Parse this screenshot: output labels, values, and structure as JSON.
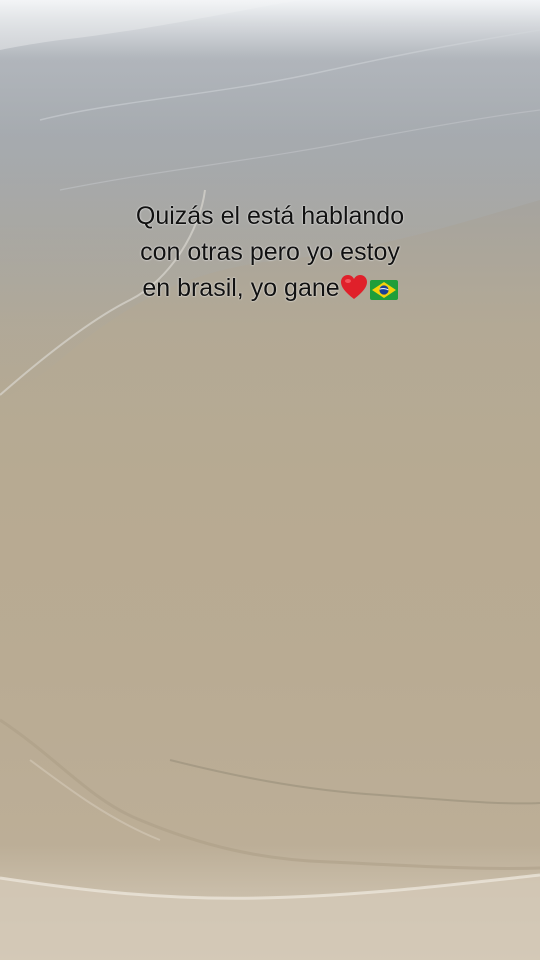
{
  "caption": {
    "line1": "Quizás el está hablando",
    "line2": "con otras pero yo estoy",
    "line3": "en brasil, yo gane"
  },
  "emojis": {
    "heart": "red-heart-emoji",
    "flag": "brazil-flag-emoji"
  },
  "colors": {
    "caption_text": "#111111",
    "heart": "#e0202a",
    "flag_green": "#1f9e3a",
    "flag_yellow": "#f5d20a",
    "flag_blue": "#1b3f94"
  }
}
